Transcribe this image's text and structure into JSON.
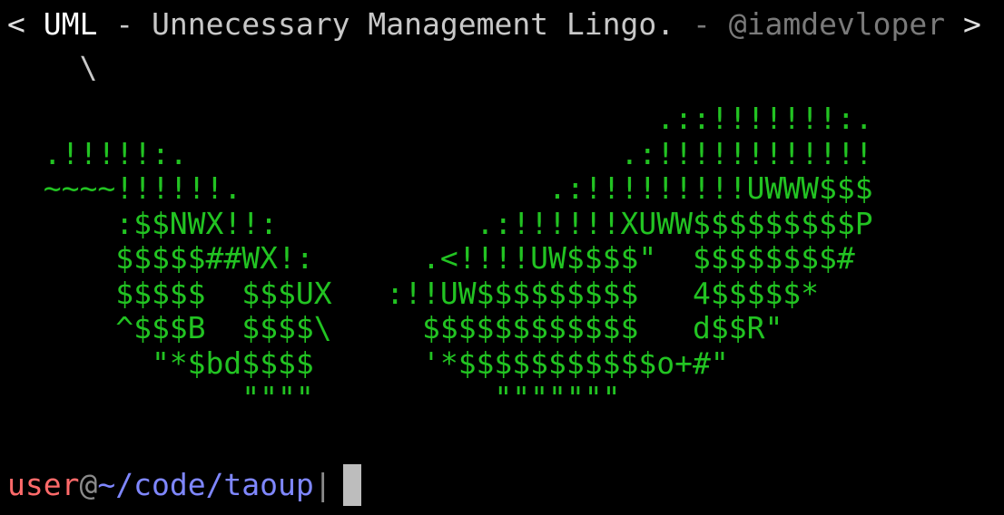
{
  "terminal": {
    "quote": {
      "open_bracket": "<",
      "term": "UML",
      "definition": " - Unnecessary Management Lingo.",
      "author": " - @iamdevloper",
      "close_bracket": ">"
    },
    "bubble_tail": "    \\",
    "art": "                                    .::!!!!!!!:.\n  .!!!!!:.                        .:!!!!!!!!!!!!\n  ~~~~!!!!!!.                 .:!!!!!!!!!UWWW$$$\n      :$$NWX!!:           .:!!!!!!XUWW$$$$$$$$$P\n      $$$$$##WX!:      .<!!!!UW$$$$\"  $$$$$$$$#\n      $$$$$  $$$UX   :!!UW$$$$$$$$$   4$$$$$*\n      ^$$$B  $$$$\\     $$$$$$$$$$$$   d$$R\"\n        \"*$bd$$$$      '*$$$$$$$$$$$o+#\"\n             \"\"\"\"          \"\"\"\"\"\"\"",
    "prompt": {
      "user": "user",
      "at": "@",
      "path": "~/code/taoup",
      "separator": "|"
    },
    "colors": {
      "background": "#000000",
      "art": "#22c322",
      "user": "#ff6a6a",
      "path": "#7f87ff",
      "cursor": "#bdbdbd"
    }
  }
}
